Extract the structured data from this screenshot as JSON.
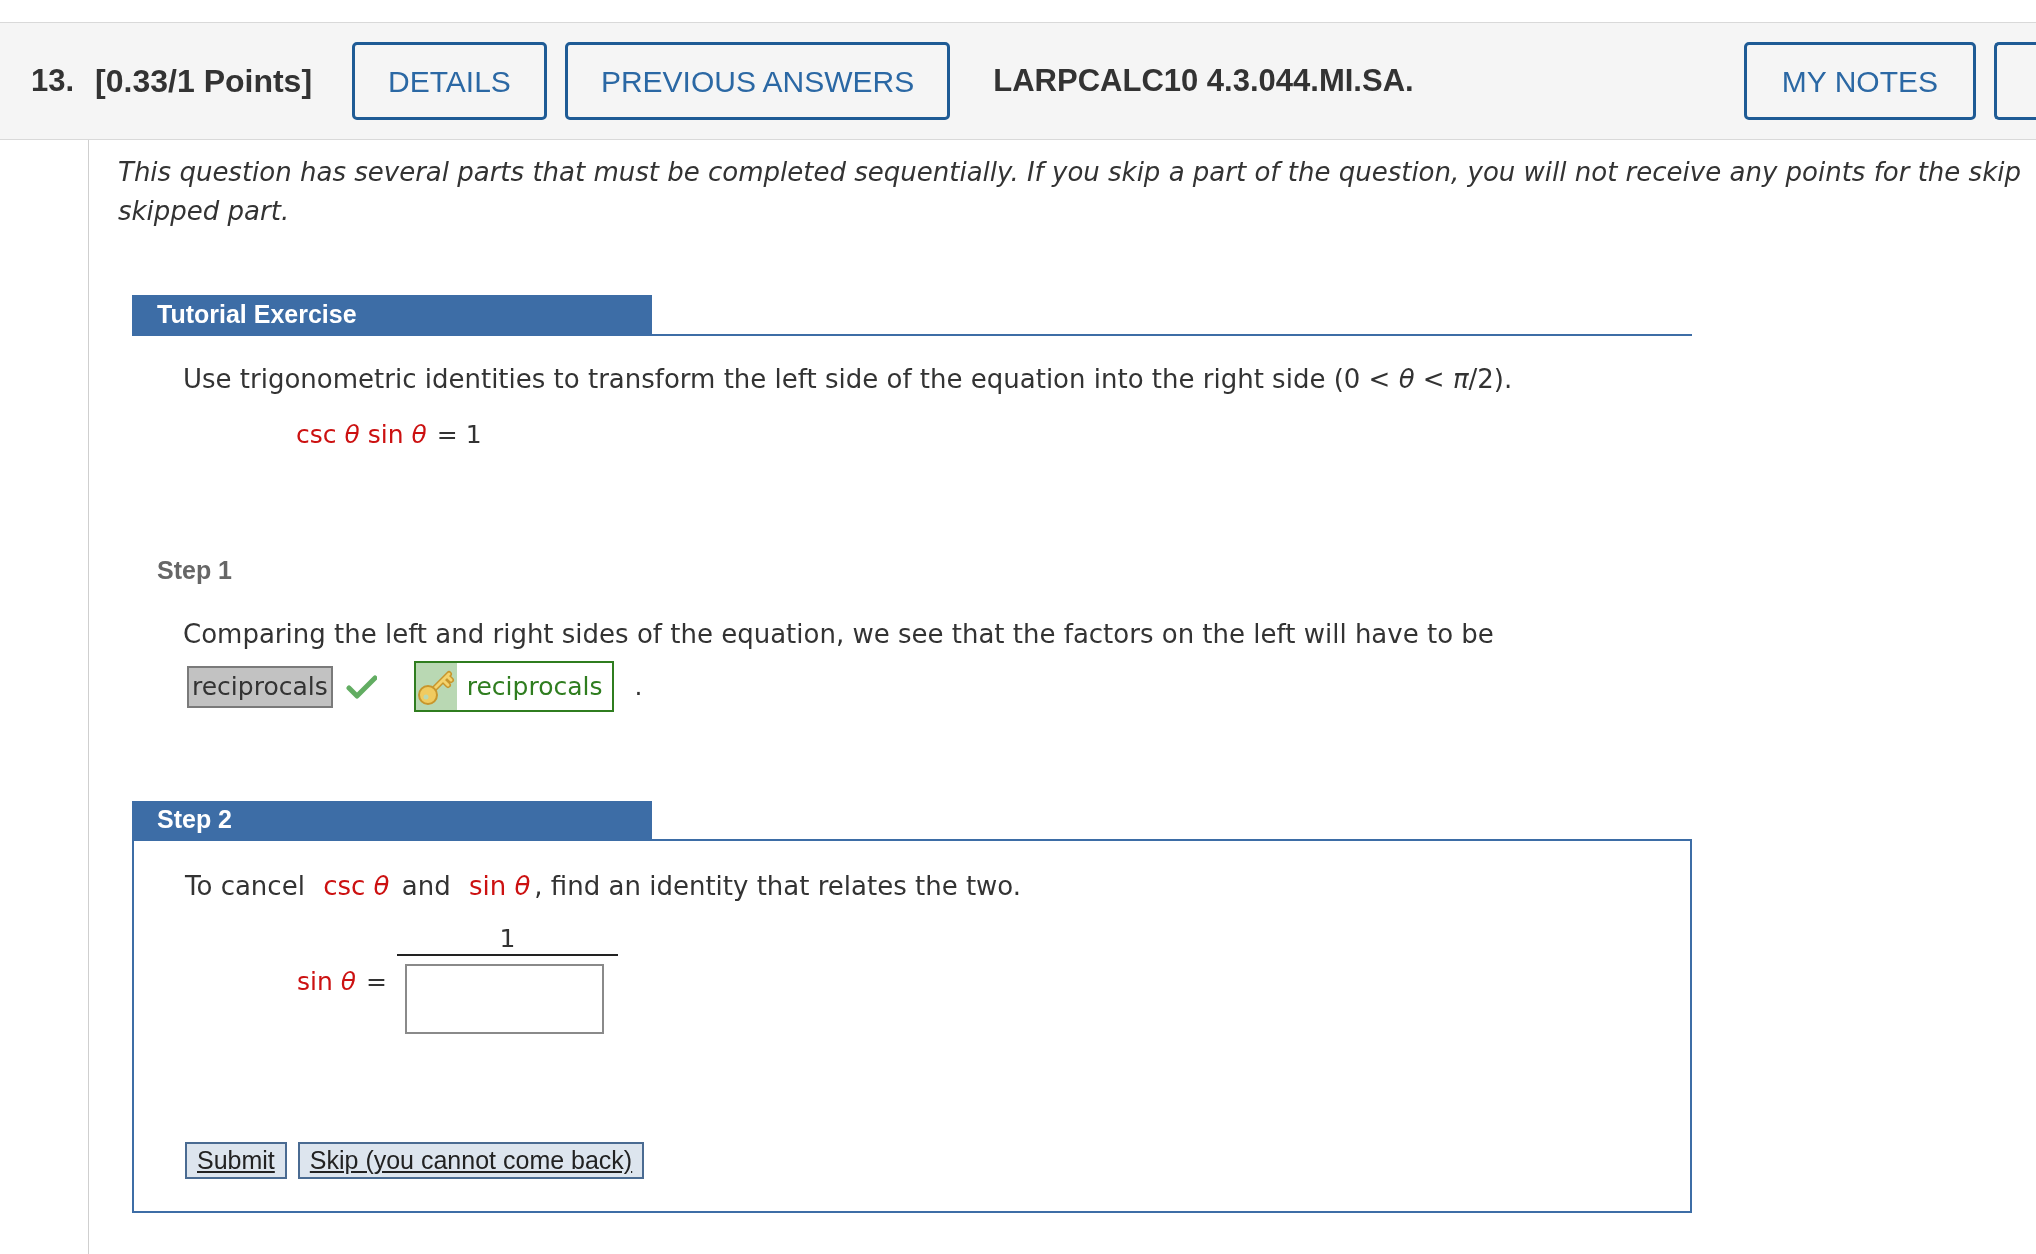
{
  "header": {
    "number": "13.",
    "points": "[0.33/1 Points]",
    "buttons": [
      {
        "label": "DETAILS"
      },
      {
        "label": "PREVIOUS ANSWERS"
      }
    ],
    "question_id": "LARPCALC10 4.3.044.MI.SA.",
    "notes_button": "MY NOTES"
  },
  "intro": {
    "line_1": "This question has several parts that must be completed sequentially. If you skip a part of the question, you will not receive any points for the skip",
    "line_2": "skipped part."
  },
  "tutorial": {
    "title": "Tutorial Exercise",
    "instruction": "Use trigonometric identities to transform the left side of the equation into the right side (0 < *θ* < *π*/2).",
    "equation": {
      "lhs": "csc *θ* sin *θ*",
      "rhs": "= 1"
    }
  },
  "step_1": {
    "title": "Step 1",
    "prompt": "Comparing the left and right sides of the equation, we see that the factors on the left will have to be",
    "answer": {
      "value": "reciprocals",
      "correct": true
    },
    "key_answer": "reciprocals",
    "end": "."
  },
  "step_2": {
    "title": "Step 2",
    "prompt": [
      {
        "text": "To cancel ",
        "math": false
      },
      {
        "text": "csc *θ*",
        "math": true
      },
      {
        "text": " and ",
        "math": false
      },
      {
        "text": "sin *θ*",
        "math": true
      },
      {
        "text": ", find an identity that relates the two.",
        "math": false
      }
    ],
    "formula": {
      "lhs": "sin *θ*",
      "relation": "=",
      "numerator": "1"
    },
    "buttons": [
      {
        "label": "Submit"
      },
      {
        "label": "Skip (you cannot come back)"
      }
    ]
  }
}
